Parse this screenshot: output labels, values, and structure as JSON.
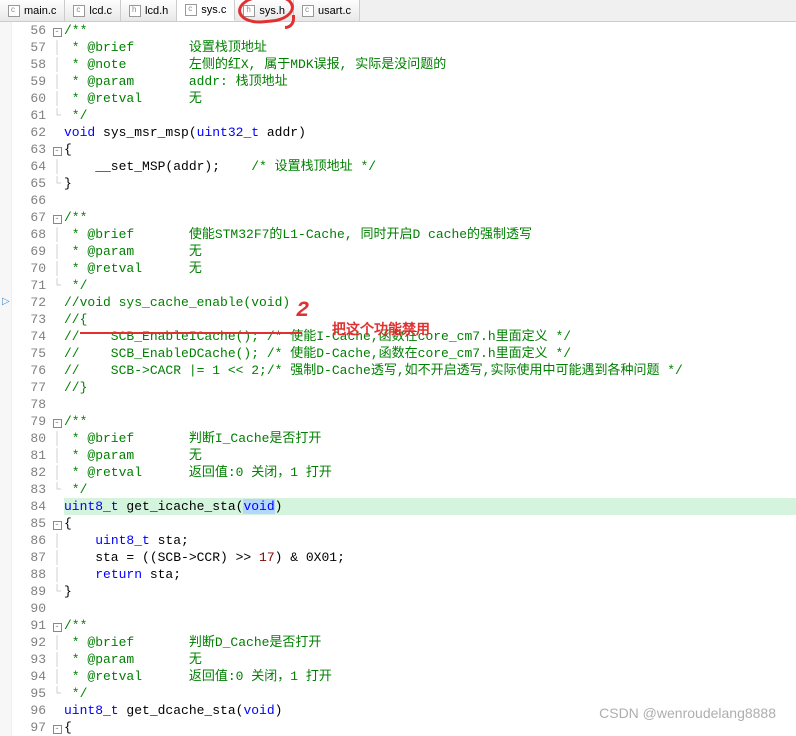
{
  "tabs": [
    {
      "label": "main.c",
      "type": "c"
    },
    {
      "label": "lcd.c",
      "type": "c"
    },
    {
      "label": "lcd.h",
      "type": "h"
    },
    {
      "label": "sys.c",
      "type": "c",
      "active": true
    },
    {
      "label": "sys.h",
      "type": "h"
    },
    {
      "label": "usart.c",
      "type": "c"
    }
  ],
  "annotations": {
    "num2": "2",
    "redtext": "把这个功能禁用"
  },
  "watermark": "CSDN @wenroudelang8888",
  "lines": [
    {
      "n": 56,
      "f": "⊟",
      "tokens": [
        {
          "t": "/**",
          "c": "cm"
        }
      ]
    },
    {
      "n": 57,
      "f": "│",
      "tokens": [
        {
          "t": " * @brief       设置栈顶地址",
          "c": "cm"
        }
      ]
    },
    {
      "n": 58,
      "f": "│",
      "tokens": [
        {
          "t": " * @note        左侧的红X, 属于MDK误报, 实际是没问题的",
          "c": "cm"
        }
      ]
    },
    {
      "n": 59,
      "f": "│",
      "tokens": [
        {
          "t": " * @param       addr: 栈顶地址",
          "c": "cm"
        }
      ]
    },
    {
      "n": 60,
      "f": "│",
      "tokens": [
        {
          "t": " * @retval      无",
          "c": "cm"
        }
      ]
    },
    {
      "n": 61,
      "f": "└",
      "tokens": [
        {
          "t": " */",
          "c": "cm"
        }
      ]
    },
    {
      "n": 62,
      "f": "",
      "tokens": [
        {
          "t": "void",
          "c": "kw"
        },
        {
          "t": " sys_msr_msp("
        },
        {
          "t": "uint32_t",
          "c": "ty"
        },
        {
          "t": " addr)"
        }
      ]
    },
    {
      "n": 63,
      "f": "⊟",
      "tokens": [
        {
          "t": "{"
        }
      ]
    },
    {
      "n": 64,
      "f": "│",
      "tokens": [
        {
          "t": "    __set_MSP(addr);    "
        },
        {
          "t": "/* 设置栈顶地址 */",
          "c": "cm"
        }
      ]
    },
    {
      "n": 65,
      "f": "└",
      "tokens": [
        {
          "t": "}"
        }
      ]
    },
    {
      "n": 66,
      "f": "",
      "tokens": [
        {
          "t": ""
        }
      ]
    },
    {
      "n": 67,
      "f": "⊟",
      "tokens": [
        {
          "t": "/**",
          "c": "cm"
        }
      ]
    },
    {
      "n": 68,
      "f": "│",
      "tokens": [
        {
          "t": " * @brief       使能STM32F7的L1-Cache, 同时开启D cache的强制透写",
          "c": "cm"
        }
      ]
    },
    {
      "n": 69,
      "f": "│",
      "tokens": [
        {
          "t": " * @param       无",
          "c": "cm"
        }
      ]
    },
    {
      "n": 70,
      "f": "│",
      "tokens": [
        {
          "t": " * @retval      无",
          "c": "cm"
        }
      ]
    },
    {
      "n": 71,
      "f": "└",
      "tokens": [
        {
          "t": " */",
          "c": "cm"
        }
      ]
    },
    {
      "n": 72,
      "f": "",
      "bp": true,
      "tokens": [
        {
          "t": "//void sys_cache_enable(void)",
          "c": "cm"
        }
      ]
    },
    {
      "n": 73,
      "f": "",
      "tokens": [
        {
          "t": "//{",
          "c": "cm"
        }
      ]
    },
    {
      "n": 74,
      "f": "",
      "tokens": [
        {
          "t": "//    SCB_EnableICache(); /* 使能I-Cache,函数在core_cm7.h里面定义 */",
          "c": "cm"
        }
      ]
    },
    {
      "n": 75,
      "f": "",
      "tokens": [
        {
          "t": "//    SCB_EnableDCache(); /* 使能D-Cache,函数在core_cm7.h里面定义 */",
          "c": "cm"
        }
      ]
    },
    {
      "n": 76,
      "f": "",
      "tokens": [
        {
          "t": "//    SCB->CACR |= 1 << 2;/* 强制D-Cache透写,如不开启透写,实际使用中可能遇到各种问题 */",
          "c": "cm"
        }
      ]
    },
    {
      "n": 77,
      "f": "",
      "tokens": [
        {
          "t": "//}",
          "c": "cm"
        }
      ]
    },
    {
      "n": 78,
      "f": "",
      "tokens": [
        {
          "t": ""
        }
      ]
    },
    {
      "n": 79,
      "f": "⊟",
      "tokens": [
        {
          "t": "/**",
          "c": "cm"
        }
      ]
    },
    {
      "n": 80,
      "f": "│",
      "tokens": [
        {
          "t": " * @brief       判断I_Cache是否打开",
          "c": "cm"
        }
      ]
    },
    {
      "n": 81,
      "f": "│",
      "tokens": [
        {
          "t": " * @param       无",
          "c": "cm"
        }
      ]
    },
    {
      "n": 82,
      "f": "│",
      "tokens": [
        {
          "t": " * @retval      返回值:0 关闭，1 打开",
          "c": "cm"
        }
      ]
    },
    {
      "n": 83,
      "f": "└",
      "tokens": [
        {
          "t": " */",
          "c": "cm"
        }
      ]
    },
    {
      "n": 84,
      "f": "",
      "hl": true,
      "tokens": [
        {
          "t": "uint8_t",
          "c": "ty"
        },
        {
          "t": " get_icache_sta("
        },
        {
          "t": "void",
          "c": "kw sel"
        },
        {
          "t": ")"
        }
      ]
    },
    {
      "n": 85,
      "f": "⊟",
      "tokens": [
        {
          "t": "{"
        }
      ]
    },
    {
      "n": 86,
      "f": "│",
      "tokens": [
        {
          "t": "    "
        },
        {
          "t": "uint8_t",
          "c": "ty"
        },
        {
          "t": " sta;"
        }
      ]
    },
    {
      "n": 87,
      "f": "│",
      "tokens": [
        {
          "t": "    sta = ((SCB->CCR) >> "
        },
        {
          "t": "17",
          "c": "num"
        },
        {
          "t": ") & 0X01;"
        }
      ]
    },
    {
      "n": 88,
      "f": "│",
      "tokens": [
        {
          "t": "    "
        },
        {
          "t": "return",
          "c": "kw"
        },
        {
          "t": " sta;"
        }
      ]
    },
    {
      "n": 89,
      "f": "└",
      "tokens": [
        {
          "t": "}"
        }
      ]
    },
    {
      "n": 90,
      "f": "",
      "tokens": [
        {
          "t": ""
        }
      ]
    },
    {
      "n": 91,
      "f": "⊟",
      "tokens": [
        {
          "t": "/**",
          "c": "cm"
        }
      ]
    },
    {
      "n": 92,
      "f": "│",
      "tokens": [
        {
          "t": " * @brief       判断D_Cache是否打开",
          "c": "cm"
        }
      ]
    },
    {
      "n": 93,
      "f": "│",
      "tokens": [
        {
          "t": " * @param       无",
          "c": "cm"
        }
      ]
    },
    {
      "n": 94,
      "f": "│",
      "tokens": [
        {
          "t": " * @retval      返回值:0 关闭，1 打开",
          "c": "cm"
        }
      ]
    },
    {
      "n": 95,
      "f": "└",
      "tokens": [
        {
          "t": " */",
          "c": "cm"
        }
      ]
    },
    {
      "n": 96,
      "f": "",
      "tokens": [
        {
          "t": "uint8_t",
          "c": "ty"
        },
        {
          "t": " get_dcache_sta("
        },
        {
          "t": "void",
          "c": "kw"
        },
        {
          "t": ")"
        }
      ]
    },
    {
      "n": 97,
      "f": "⊟",
      "tokens": [
        {
          "t": "{"
        }
      ]
    }
  ]
}
